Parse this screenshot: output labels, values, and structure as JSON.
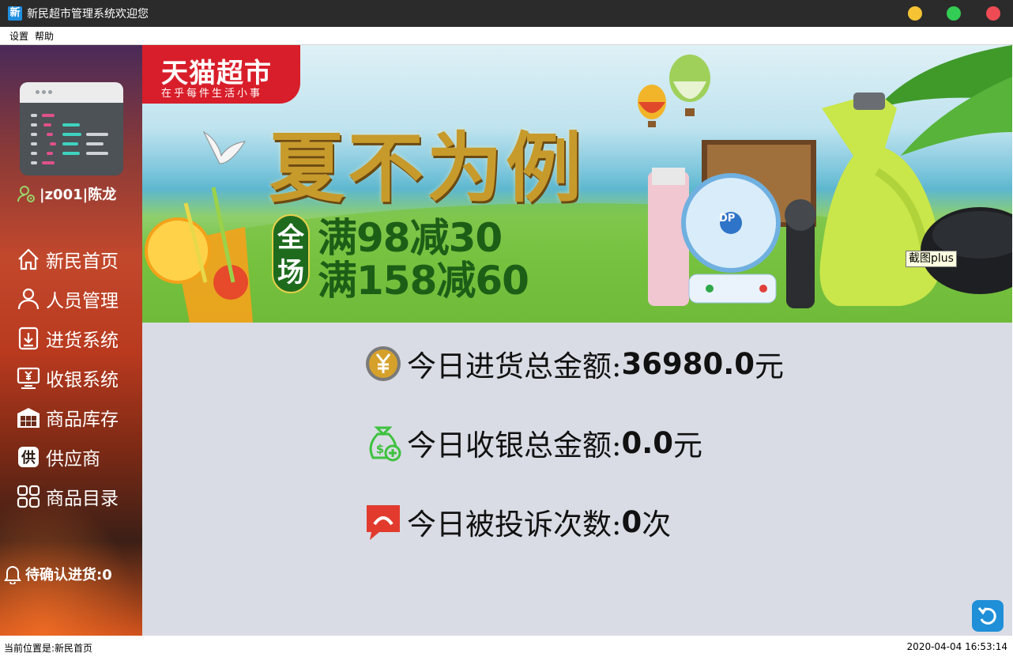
{
  "window": {
    "icon_text": "新",
    "title": "新民超市管理系统欢迎您"
  },
  "menu": {
    "items": [
      {
        "label": "设置"
      },
      {
        "label": "帮助"
      }
    ]
  },
  "sidebar": {
    "user": "|z001|陈龙",
    "nav": [
      {
        "label": "新民首页",
        "icon": "home-icon"
      },
      {
        "label": "人员管理",
        "icon": "person-icon"
      },
      {
        "label": "进货系统",
        "icon": "download-box-icon"
      },
      {
        "label": "收银系统",
        "icon": "cashier-monitor-icon"
      },
      {
        "label": "商品库存",
        "icon": "warehouse-icon"
      },
      {
        "label": "供应商",
        "icon": "supplier-icon"
      },
      {
        "label": "商品目录",
        "icon": "grid-catalog-icon"
      }
    ],
    "pending": "待确认进货:0"
  },
  "banner": {
    "brand_title": "天猫超市",
    "brand_subtitle": "在乎每件生活小事",
    "headline": "夏不为例",
    "badge": "全场",
    "promo_line1": "满98减30",
    "promo_line2": "满158减60",
    "fan_brand": "DP",
    "tooltip": "截图plus"
  },
  "stats": [
    {
      "label": "今日进货总金额:",
      "value": "36980.0",
      "unit": "元",
      "icon": "yuan-coin-icon"
    },
    {
      "label": "今日收银总金额:",
      "value": "0.0",
      "unit": "元",
      "icon": "money-bag-icon"
    },
    {
      "label": "今日被投诉次数:",
      "value": "0",
      "unit": "次",
      "icon": "complaint-bubble-icon"
    }
  ],
  "colors": {
    "titlebar": "#2b2b2b",
    "content_bg": "#d9dce4",
    "minimize": "#f5c333",
    "maximize": "#33cc55",
    "close": "#ef4b55",
    "accent_blue": "#1f8fd8",
    "complaint_red": "#e23b2e",
    "money_green": "#3ec23e",
    "coin_gold": "#d6a12a"
  },
  "status": {
    "location": "当前位置是:新民首页",
    "datetime": "2020-04-04 16:53:14"
  }
}
